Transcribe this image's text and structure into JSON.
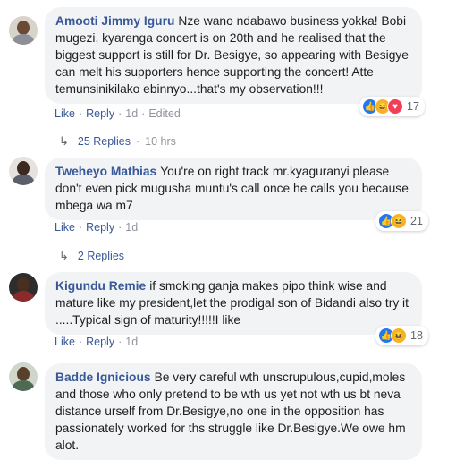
{
  "comments": [
    {
      "author": "Amooti Jimmy Iguru",
      "text": "Nze wano ndabawo business yokka! Bobi mugezi, kyarenga concert is on 20th and he realised that the biggest support is still for Dr. Besigye, so appearing with Besigye can melt his supporters hence supporting the concert! Atte temunsinikilako ebinnyo...that's my observation!!!",
      "like": "Like",
      "reply": "Reply",
      "time": "1d",
      "edited": "Edited",
      "reaction_count": "17",
      "replies_label": "25 Replies",
      "replies_time": "10 hrs"
    },
    {
      "author": "Tweheyo Mathias",
      "text": "You're on right track mr.kyaguranyi please don't even pick mugusha muntu's call once he calls you because mbega wa m7",
      "like": "Like",
      "reply": "Reply",
      "time": "1d",
      "reaction_count": "21",
      "replies_label": "2 Replies"
    },
    {
      "author": "Kigundu Remie",
      "text": "if smoking ganja makes pipo think wise and mature like my president,let the prodigal son of Bidandi also try it .....Typical sign of maturity!!!!!I like",
      "like": "Like",
      "reply": "Reply",
      "time": "1d",
      "reaction_count": "18"
    },
    {
      "author": "Badde Ignicious",
      "text": "Be very careful wth unscrupulous,cupid,moles and those who only pretend to be wth us yet not wth us bt neva distance urself from Dr.Besigye,no one in the opposition has passionately worked for ths struggle like Dr.Besigye.We owe hm alot."
    }
  ],
  "icons": {
    "like": "thumbs-up-icon",
    "haha": "laughing-face-icon",
    "love": "heart-icon",
    "reply_arrow": "reply-arrow-icon"
  },
  "colors": {
    "link": "#385898",
    "bubble": "#f2f3f5",
    "like": "#2078f4",
    "haha": "#f7b125",
    "love": "#f33e58"
  }
}
